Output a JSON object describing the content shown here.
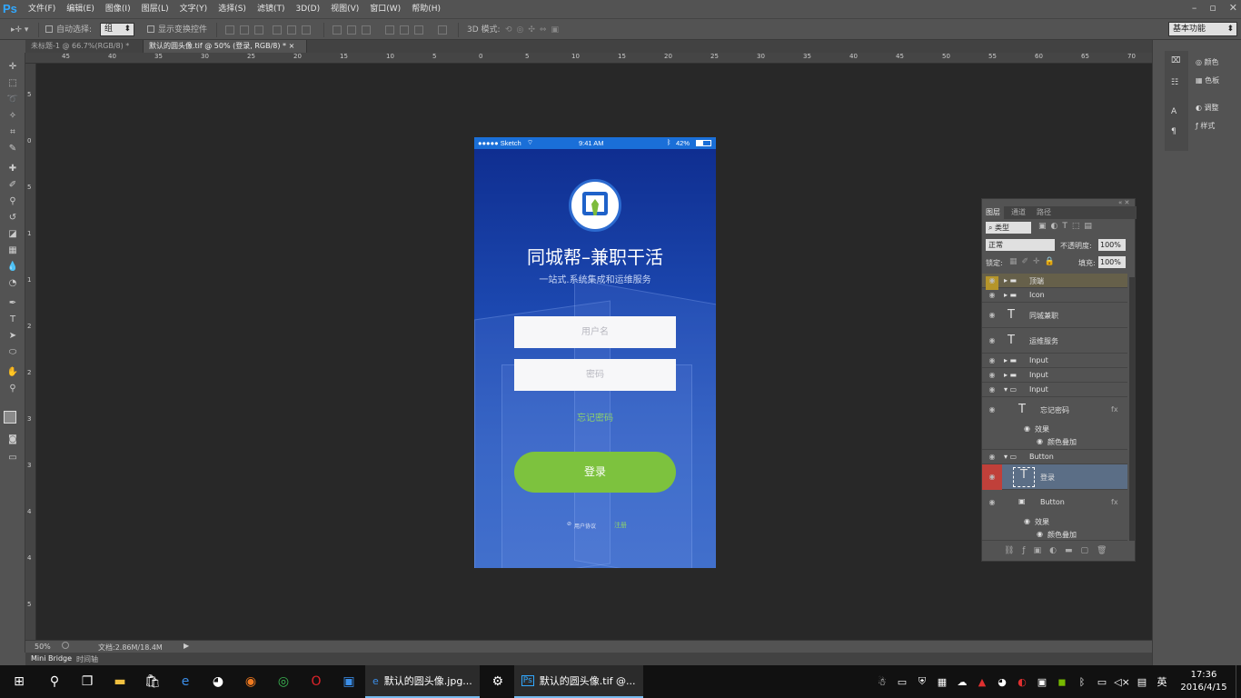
{
  "app": {
    "logo": "Ps"
  },
  "menu": [
    "文件(F)",
    "编辑(E)",
    "图像(I)",
    "图层(L)",
    "文字(Y)",
    "选择(S)",
    "滤镜(T)",
    "3D(D)",
    "视图(V)",
    "窗口(W)",
    "帮助(H)"
  ],
  "options": {
    "auto_select_label": "自动选择:",
    "auto_select_value": "组",
    "show_transform_label": "显示变换控件",
    "mode3d_label": "3D 模式:",
    "workspace": "基本功能"
  },
  "tabs": [
    {
      "label": "未标题-1 @ 66.7%(RGB/8) *",
      "close": "×"
    },
    {
      "label": "默认的圆头像.tif @ 50% (登录, RGB/8) *",
      "close": "×"
    }
  ],
  "ruler_top": [
    "45",
    "40",
    "35",
    "30",
    "25",
    "20",
    "15",
    "10",
    "5",
    "0",
    "5",
    "10",
    "15",
    "20",
    "25",
    "30",
    "35",
    "40",
    "45",
    "50",
    "55",
    "60",
    "65",
    "70"
  ],
  "ruler_left": [
    "5",
    "0",
    "5",
    "1",
    "1",
    "2",
    "2",
    "3",
    "3",
    "4",
    "4",
    "5"
  ],
  "phone": {
    "carrier": "●●●●● Sketch",
    "time": "9:41 AM",
    "battery": "42%",
    "title": "同城帮–兼职干活",
    "subtitle": "一站式.系统集成和运维服务",
    "username_placeholder": "用户名",
    "password_placeholder": "密码",
    "forgot": "忘记密码",
    "login": "登录",
    "agree": "用户协议",
    "register": "注册"
  },
  "status": {
    "zoom": "50%",
    "doc": "文档:2.86M/18.4M"
  },
  "bottom_tabs": [
    "Mini Bridge",
    "时间轴"
  ],
  "color_panel": [
    "颜色",
    "色板",
    "调整",
    "样式"
  ],
  "layers_panel": {
    "tabs": [
      "图层",
      "通道",
      "路径"
    ],
    "filter": "类型",
    "blend": "正常",
    "opacity_label": "不透明度:",
    "opacity": "100%",
    "lock_label": "锁定:",
    "fill_label": "填充:",
    "fill": "100%",
    "layers": [
      {
        "name": "顶端",
        "type": "group"
      },
      {
        "name": "Icon",
        "type": "group"
      },
      {
        "name": "同城兼职",
        "type": "text"
      },
      {
        "name": "运维服务",
        "type": "text"
      },
      {
        "name": "Input",
        "type": "group"
      },
      {
        "name": "Input",
        "type": "group"
      },
      {
        "name": "Input",
        "type": "group-open"
      },
      {
        "name": "忘记密码",
        "type": "text"
      },
      {
        "name": "效果",
        "type": "effect"
      },
      {
        "name": "颜色叠加",
        "type": "effect-item"
      },
      {
        "name": "Button",
        "type": "group-open"
      },
      {
        "name": "登录",
        "type": "text-selected"
      },
      {
        "name": "Button",
        "type": "shape"
      },
      {
        "name": "效果",
        "type": "effect"
      },
      {
        "name": "颜色叠加",
        "type": "effect-item"
      }
    ]
  },
  "taskbar": {
    "windows": [
      {
        "label": "默认的圆头像.jpg...",
        "icon": "e"
      },
      {
        "label": "默认的圆头像.tif @...",
        "icon": "Ps"
      }
    ],
    "lang": "英",
    "time": "17:36",
    "date": "2016/4/15"
  }
}
